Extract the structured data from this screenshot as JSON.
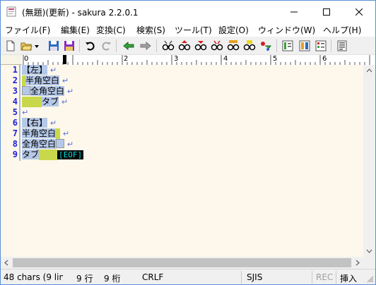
{
  "window": {
    "title": "(無題)(更新) - sakura 2.2.0.1"
  },
  "menu": {
    "items": [
      {
        "label": "ファイル(F)"
      },
      {
        "label": "編集(E)"
      },
      {
        "label": "変換(C)"
      },
      {
        "label": "検索(S)"
      },
      {
        "label": "ツール(T)"
      },
      {
        "label": "設定(O)"
      },
      {
        "label": "ウィンドウ(W)"
      },
      {
        "label": "ヘルプ(H)"
      }
    ]
  },
  "toolbar": {
    "icons": [
      "new-file-icon",
      "open-folder-icon",
      "dropdown-icon",
      "save-icon",
      "save-all-icon",
      "undo-icon",
      "redo-icon",
      "jump-back-icon",
      "jump-forward-icon",
      "search-icon",
      "search-prev-icon",
      "search-next-icon",
      "replace-icon",
      "grep-icon",
      "tag-jump-icon",
      "outline-icon",
      "compare-icon",
      "print-icon",
      "settings-icon",
      "wrap-icon"
    ]
  },
  "ruler": {
    "labels": [
      "0",
      "1",
      "2",
      "3",
      "4",
      "5",
      "6"
    ]
  },
  "editor": {
    "lines": [
      {
        "num": "1",
        "text": "【左】"
      },
      {
        "num": "2",
        "text": "半角空白"
      },
      {
        "num": "3",
        "text": "全角空白"
      },
      {
        "num": "4",
        "text": "タブ"
      },
      {
        "num": "5",
        "text": ""
      },
      {
        "num": "6",
        "text": "【右】"
      },
      {
        "num": "7",
        "text": "半角空白"
      },
      {
        "num": "8",
        "text": "全角空白"
      },
      {
        "num": "9",
        "text": "タブ"
      }
    ],
    "eof_label": "[EOF]",
    "lf_mark": "↵"
  },
  "status": {
    "chars": "48 chars (9 line",
    "row": "9 行",
    "col": "9 桁",
    "eol": "CRLF",
    "encoding": "SJIS",
    "rec": "REC",
    "mode": "挿入"
  },
  "colors": {
    "line_number": "#2020d8",
    "selection": "#b4c8e8",
    "tab_mark": "#c8d84a",
    "editor_bg": "#fdf8eb"
  }
}
